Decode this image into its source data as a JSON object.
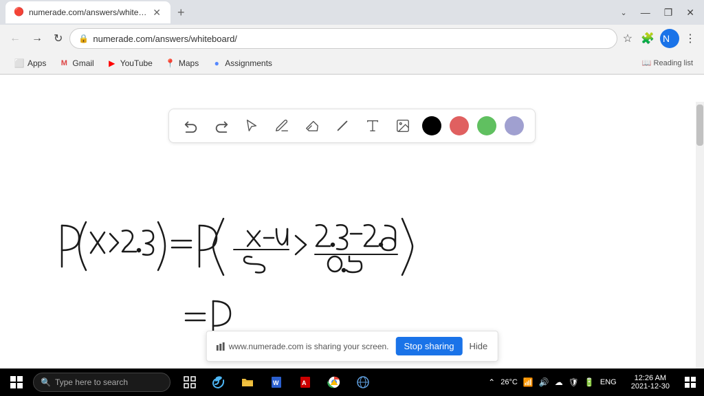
{
  "browser": {
    "tab": {
      "title": "numerade.com/answers/whiteboard/",
      "favicon": "🔴"
    },
    "address": "numerade.com/answers/whiteboard/",
    "bookmarks": [
      {
        "label": "Apps",
        "icon": "⬜"
      },
      {
        "label": "Gmail",
        "icon": "M"
      },
      {
        "label": "YouTube",
        "icon": "▶"
      },
      {
        "label": "Maps",
        "icon": "📍"
      },
      {
        "label": "Assignments",
        "icon": "🔵"
      }
    ]
  },
  "toolbar": {
    "undo_label": "↺",
    "redo_label": "↻",
    "colors": [
      "#000000",
      "#e06060",
      "#60c060",
      "#a0a0d0"
    ]
  },
  "sharing_banner": {
    "indicator_text": "www.numerade.com is sharing your screen.",
    "stop_button_label": "Stop sharing",
    "hide_button_label": "Hide"
  },
  "taskbar": {
    "search_placeholder": "Type here to search",
    "temperature": "26°C",
    "language": "ENG",
    "time": "12:26 AM",
    "date": "2021-12-30"
  }
}
